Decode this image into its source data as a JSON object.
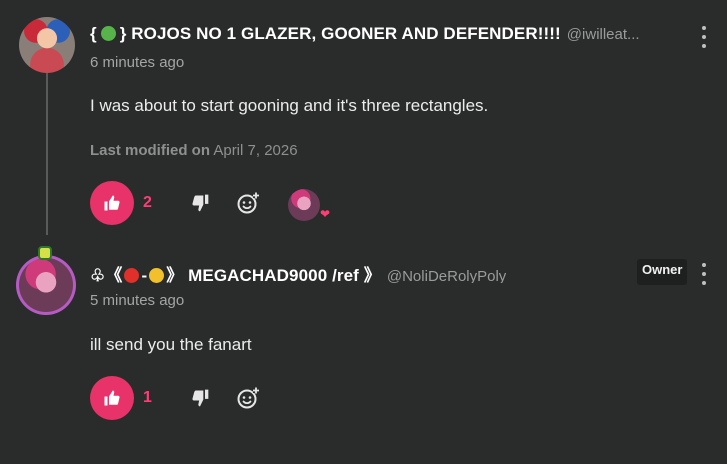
{
  "comments": [
    {
      "username_prefix": "{",
      "username": "} ROJOS NO 1 GLAZER, GOONER AND DEFENDER!!!!",
      "handle": "@iwilleat...",
      "timestamp": "6 minutes ago",
      "body": "I was about to start gooning and it's three rectangles.",
      "modified_label": "Last modified on",
      "modified_date": "April 7, 2026",
      "like_count": "2",
      "icons": {
        "like": "thumbs-up-icon",
        "dislike": "thumbs-down-icon",
        "react": "add-reaction-icon",
        "more": "kebab-menu-icon"
      }
    },
    {
      "username_prefix": "♧《",
      "username_sep": "-",
      "username": "》 MEGACHAD9000 /ref 》",
      "handle": "@NoliDeRolyPoly",
      "timestamp": "5 minutes ago",
      "body": "ill send you the fanart",
      "owner_badge": "Owner",
      "like_count": "1",
      "icons": {
        "like": "thumbs-up-icon",
        "dislike": "thumbs-down-icon",
        "react": "add-reaction-icon",
        "more": "kebab-menu-icon"
      }
    }
  ],
  "colors": {
    "background": "#2a2b2b",
    "accent": "#e8336a",
    "like_count": "#ff3d78"
  }
}
